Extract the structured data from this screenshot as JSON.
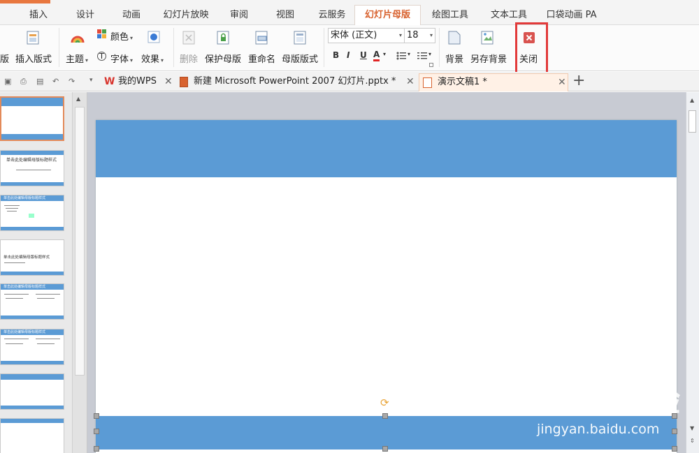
{
  "tabs": [
    "插入",
    "设计",
    "动画",
    "幻灯片放映",
    "审阅",
    "视图",
    "云服务",
    "幻灯片母版",
    "绘图工具",
    "文本工具",
    "口袋动画 PA"
  ],
  "active_tab": "幻灯片母版",
  "ribbon": {
    "cut_label": "版",
    "insert_layout": "插入版式",
    "theme": "主题",
    "color": "颜色",
    "font": "字体",
    "effect": "效果",
    "delete": "删除",
    "protect_master": "保护母版",
    "rename": "重命名",
    "master_layout": "母版版式",
    "font_name": "宋体 (正文)",
    "font_size": "18",
    "bold": "B",
    "italic": "I",
    "underline": "U",
    "font_color": "A",
    "background": "背景",
    "save_background": "另存背景",
    "close": "关闭"
  },
  "doc_tabs": [
    {
      "label": "我的WPS",
      "icon": "wps-icon",
      "active": false
    },
    {
      "label": "新建 Microsoft PowerPoint 2007 幻灯片.pptx *",
      "icon": "pptx-file-icon",
      "active": false
    },
    {
      "label": "演示文稿1 *",
      "icon": "presentation-file-icon",
      "active": true
    }
  ],
  "thumbnail_titles": [
    "",
    "单击此处编辑母版标题样式",
    "单击此处编辑母版标题样式",
    "单击此处编辑母版标题样式",
    "单击此处编辑母版标题样式",
    "单击此处编辑母版标题样式",
    "",
    ""
  ],
  "watermark": {
    "logo": "Baidu经验",
    "url": "jingyan.baidu.com"
  },
  "colors": {
    "accent": "#d8622f",
    "slide_bar": "#5b9bd5",
    "close_red": "#d9534f",
    "highlight": "#e23a3a"
  }
}
